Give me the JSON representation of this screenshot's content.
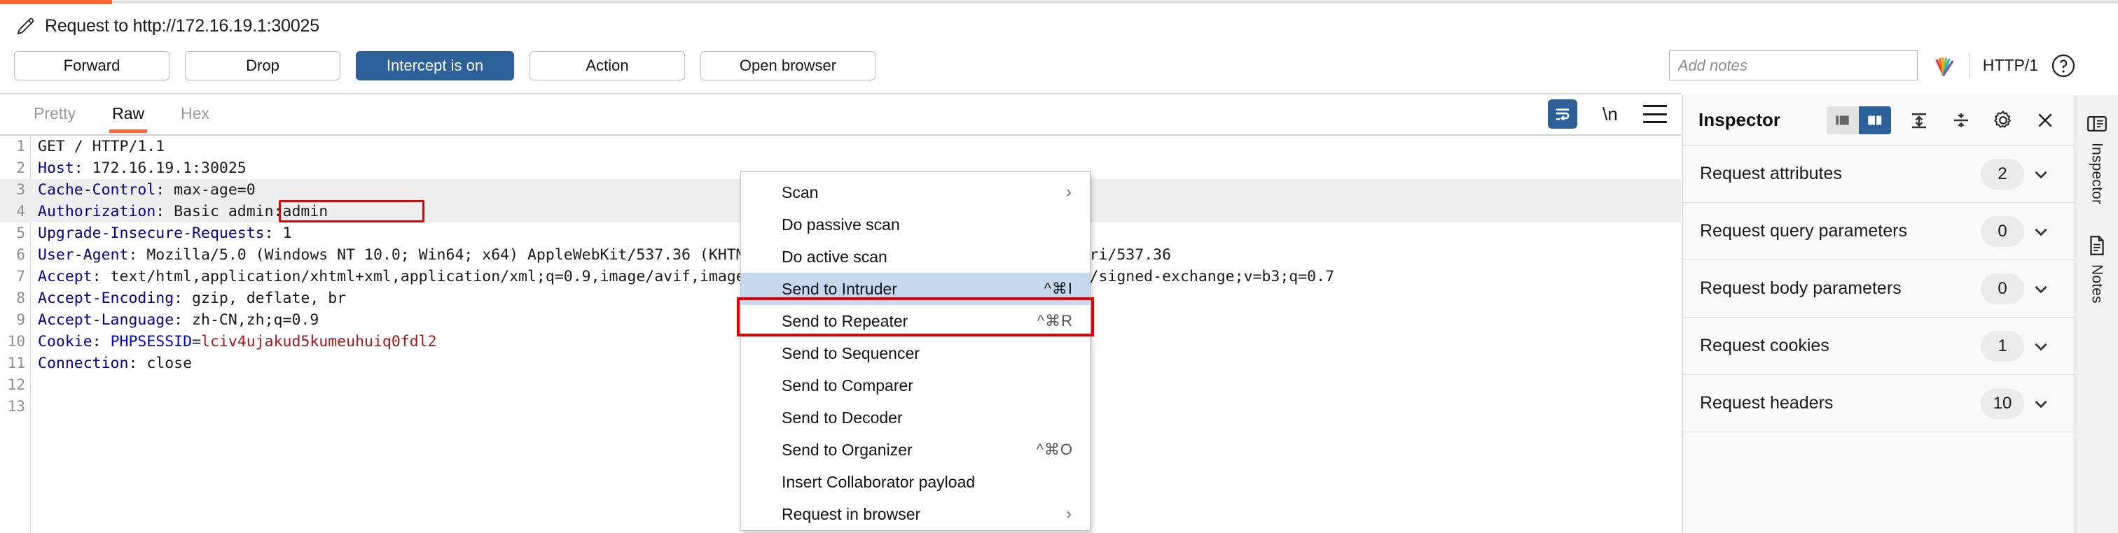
{
  "window": {
    "accent_color": "#ff6633",
    "primary_color": "#2b6098"
  },
  "header": {
    "title": "Request to http://172.16.19.1:30025",
    "pencil_icon": "pencil-icon"
  },
  "toolbar": {
    "forward_label": "Forward",
    "drop_label": "Drop",
    "intercept_label": "Intercept is on",
    "action_label": "Action",
    "open_browser_label": "Open browser",
    "notes_placeholder": "Add notes",
    "notes_value": "",
    "http_version_label": "HTTP/1",
    "help_icon": "help-circle-icon",
    "burp_logo_icon": "burp-logo-icon"
  },
  "editor": {
    "tabs": [
      {
        "label": "Pretty",
        "active": false
      },
      {
        "label": "Raw",
        "active": true
      },
      {
        "label": "Hex",
        "active": false
      }
    ],
    "tools": {
      "word_wrap_icon": "word-wrap-icon",
      "newline_label": "\\n",
      "menu_icon": "hamburger-menu-icon"
    },
    "lines": [
      {
        "no": "1",
        "shaded": false,
        "segments": [
          {
            "t": "GET / HTTP/1.1",
            "c": "val"
          }
        ]
      },
      {
        "no": "2",
        "shaded": false,
        "segments": [
          {
            "t": "Host",
            "c": "hdr"
          },
          {
            "t": ": 172.16.19.1:30025",
            "c": "val"
          }
        ]
      },
      {
        "no": "3",
        "shaded": true,
        "segments": [
          {
            "t": "Cache-Control",
            "c": "hdr"
          },
          {
            "t": ": max-age=0",
            "c": "val"
          }
        ]
      },
      {
        "no": "4",
        "shaded": true,
        "segments": [
          {
            "t": "Authorization",
            "c": "hdr"
          },
          {
            "t": ": Basic admin:admin",
            "c": "val"
          }
        ]
      },
      {
        "no": "5",
        "shaded": false,
        "segments": [
          {
            "t": "Upgrade-Insecure-Requests",
            "c": "hdr"
          },
          {
            "t": ": 1",
            "c": "val"
          }
        ]
      },
      {
        "no": "6",
        "shaded": false,
        "segments": [
          {
            "t": "User-Agent",
            "c": "hdr"
          },
          {
            "t": ": Mozilla/5.0 (Windows NT 10.0; Win64; x64) AppleWebKit/537.36 (KHTML, like Gecko) Chrome/120.6099.71 Safari/537.36",
            "c": "val"
          }
        ]
      },
      {
        "no": "7",
        "shaded": false,
        "segments": [
          {
            "t": "Accept",
            "c": "hdr"
          },
          {
            "t": ": text/html,application/xhtml+xml,application/xml;q=0.9,image/avif,image/webp,image/apng,*/*;q=0.8,application/signed-exchange;v=b3;q=0.7",
            "c": "val"
          }
        ]
      },
      {
        "no": "8",
        "shaded": false,
        "segments": [
          {
            "t": "Accept-Encoding",
            "c": "hdr"
          },
          {
            "t": ": gzip, deflate, br",
            "c": "val"
          }
        ]
      },
      {
        "no": "9",
        "shaded": false,
        "segments": [
          {
            "t": "Accept-Language",
            "c": "hdr"
          },
          {
            "t": ": zh-CN,zh;q=0.9",
            "c": "val"
          }
        ]
      },
      {
        "no": "10",
        "shaded": false,
        "segments": [
          {
            "t": "Cookie",
            "c": "hdr"
          },
          {
            "t": ": ",
            "c": "val"
          },
          {
            "t": "PHPSESSID",
            "c": "cookiename"
          },
          {
            "t": "=",
            "c": "val"
          },
          {
            "t": "lciv4ujakud5kumeuhuiq0fdl2",
            "c": "cookieval"
          }
        ]
      },
      {
        "no": "11",
        "shaded": false,
        "segments": [
          {
            "t": "Connection",
            "c": "hdr"
          },
          {
            "t": ": close",
            "c": "val"
          }
        ]
      },
      {
        "no": "12",
        "shaded": false,
        "segments": []
      },
      {
        "no": "13",
        "shaded": false,
        "segments": []
      }
    ],
    "highlight_label": "admin:admin"
  },
  "context_menu": {
    "items": [
      {
        "label": "Scan",
        "shortcut": "",
        "submenu": true,
        "selected": false
      },
      {
        "label": "Do passive scan",
        "shortcut": "",
        "submenu": false,
        "selected": false
      },
      {
        "label": "Do active scan",
        "shortcut": "",
        "submenu": false,
        "selected": false
      },
      {
        "label": "Send to Intruder",
        "shortcut": "^⌘I",
        "submenu": false,
        "selected": true
      },
      {
        "label": "Send to Repeater",
        "shortcut": "^⌘R",
        "submenu": false,
        "selected": false
      },
      {
        "label": "Send to Sequencer",
        "shortcut": "",
        "submenu": false,
        "selected": false
      },
      {
        "label": "Send to Comparer",
        "shortcut": "",
        "submenu": false,
        "selected": false
      },
      {
        "label": "Send to Decoder",
        "shortcut": "",
        "submenu": false,
        "selected": false
      },
      {
        "label": "Send to Organizer",
        "shortcut": "^⌘O",
        "submenu": false,
        "selected": false
      },
      {
        "label": "Insert Collaborator payload",
        "shortcut": "",
        "submenu": false,
        "selected": false
      },
      {
        "label": "Request in browser",
        "shortcut": "",
        "submenu": true,
        "selected": false
      }
    ]
  },
  "inspector": {
    "title": "Inspector",
    "header_icons": {
      "layout_left_icon": "layout-left-icon",
      "layout_right_icon": "layout-right-icon",
      "expand_all_icon": "expand-all-icon",
      "collapse_all_icon": "collapse-all-icon",
      "settings_icon": "gear-icon",
      "close_icon": "close-icon"
    },
    "rows": [
      {
        "label": "Request attributes",
        "count": "2"
      },
      {
        "label": "Request query parameters",
        "count": "0"
      },
      {
        "label": "Request body parameters",
        "count": "0"
      },
      {
        "label": "Request cookies",
        "count": "1"
      },
      {
        "label": "Request headers",
        "count": "10"
      }
    ]
  },
  "rail": {
    "inspector_icon": "inspector-panel-icon",
    "inspector_label": "Inspector",
    "notes_icon": "notes-page-icon",
    "notes_label": "Notes"
  }
}
